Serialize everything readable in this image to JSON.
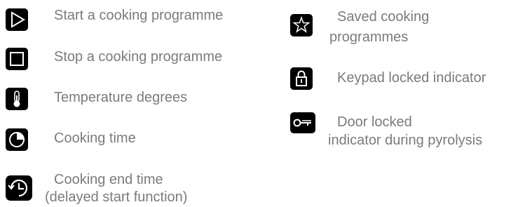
{
  "legend": {
    "items": [
      {
        "icon": "play-triangle-icon",
        "label": "Start a cooking programme"
      },
      {
        "icon": "stop-square-icon",
        "label": "Stop a cooking programme"
      },
      {
        "icon": "thermometer-icon",
        "label": "Temperature degrees"
      },
      {
        "icon": "timer-icon",
        "label": "Cooking time"
      },
      {
        "icon": "end-time-clock-icon",
        "label_line1": "Cooking end time",
        "label_line2": "(delayed start function)"
      },
      {
        "icon": "star-icon",
        "label_line1": "Saved cooking",
        "label_line2": "programmes"
      },
      {
        "icon": "padlock-icon",
        "label": "Keypad locked indicator"
      },
      {
        "icon": "key-icon",
        "label_line1": "Door locked",
        "label_line2": "indicator during pyrolysis"
      }
    ]
  }
}
